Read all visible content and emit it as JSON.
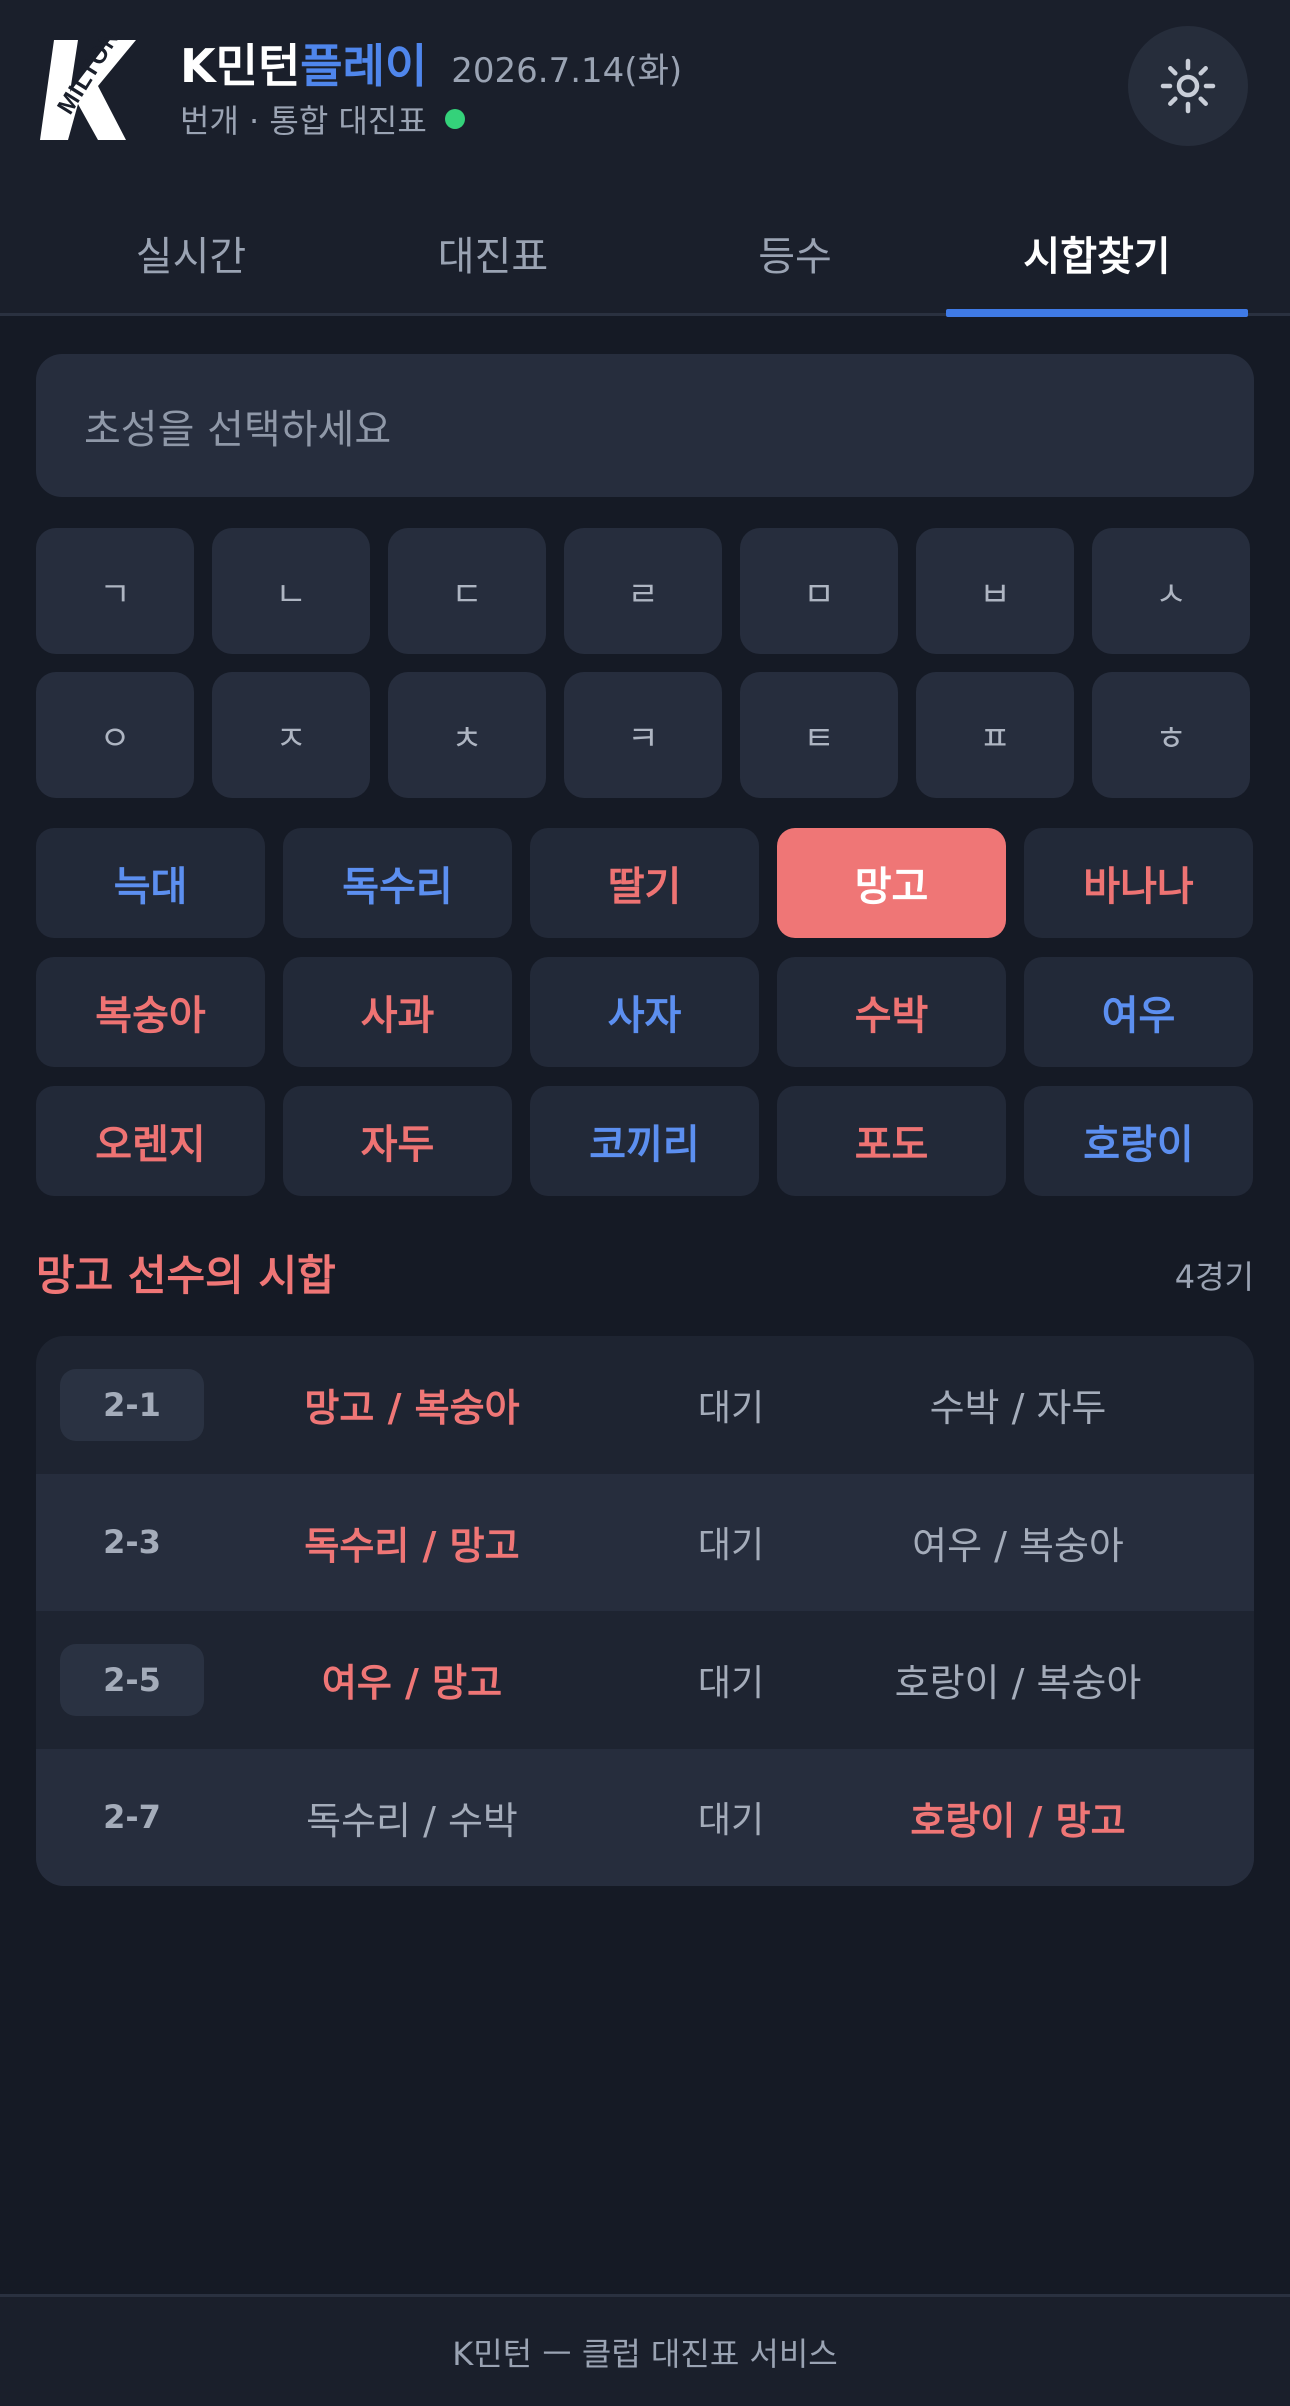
{
  "header": {
    "logo_text": "MILTON",
    "brand_k": "K민턴",
    "brand_play": "플레이",
    "date": "2026.7.14(화)",
    "subtitle": "번개 · 통합 대진표",
    "live_color": "#34d27a",
    "settings_icon": "gear-icon"
  },
  "tabs": [
    {
      "label": "실시간",
      "active": false
    },
    {
      "label": "대진표",
      "active": false
    },
    {
      "label": "등수",
      "active": false
    },
    {
      "label": "시합찾기",
      "active": true
    }
  ],
  "search": {
    "placeholder": "초성을 선택하세요"
  },
  "chosung": [
    "ㄱ",
    "ㄴ",
    "ㄷ",
    "ㄹ",
    "ㅁ",
    "ㅂ",
    "ㅅ",
    "ㅇ",
    "ㅈ",
    "ㅊ",
    "ㅋ",
    "ㅌ",
    "ㅍ",
    "ㅎ"
  ],
  "players": [
    {
      "name": "늑대",
      "color": "blue"
    },
    {
      "name": "독수리",
      "color": "blue"
    },
    {
      "name": "딸기",
      "color": "red"
    },
    {
      "name": "망고",
      "color": "red",
      "selected": true
    },
    {
      "name": "바나나",
      "color": "red"
    },
    {
      "name": "복숭아",
      "color": "red"
    },
    {
      "name": "사과",
      "color": "red"
    },
    {
      "name": "사자",
      "color": "blue"
    },
    {
      "name": "수박",
      "color": "red"
    },
    {
      "name": "여우",
      "color": "blue"
    },
    {
      "name": "오렌지",
      "color": "red"
    },
    {
      "name": "자두",
      "color": "red"
    },
    {
      "name": "코끼리",
      "color": "blue"
    },
    {
      "name": "포도",
      "color": "red"
    },
    {
      "name": "호랑이",
      "color": "blue"
    }
  ],
  "results": {
    "title": "망고 선수의 시합",
    "count": "4경기",
    "matches": [
      {
        "court": "2-1",
        "team_a": "망고 / 복숭아",
        "status": "대기",
        "team_b": "수박 / 자두",
        "highlight": "a"
      },
      {
        "court": "2-3",
        "team_a": "독수리 / 망고",
        "status": "대기",
        "team_b": "여우 / 복숭아",
        "highlight": "a"
      },
      {
        "court": "2-5",
        "team_a": "여우 / 망고",
        "status": "대기",
        "team_b": "호랑이 / 복숭아",
        "highlight": "a"
      },
      {
        "court": "2-7",
        "team_a": "독수리 / 수박",
        "status": "대기",
        "team_b": "호랑이 / 망고",
        "highlight": "b"
      }
    ]
  },
  "footer": {
    "text": "K민턴 ㅡ 클럽 대진표 서비스"
  },
  "colors": {
    "accent_blue": "#4f86ec",
    "accent_red": "#ef7676",
    "background": "#151a25"
  }
}
